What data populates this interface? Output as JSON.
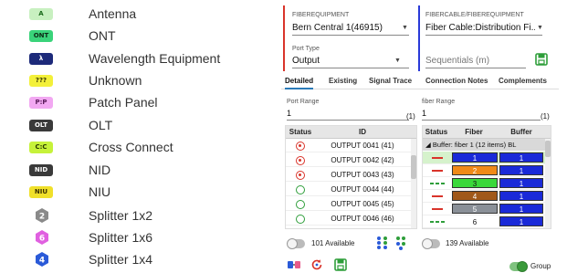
{
  "legend": [
    {
      "badge": "A",
      "label": "Antenna",
      "bg": "#c8f0c0",
      "fg": "#1b6b1b",
      "shape": "badge"
    },
    {
      "badge": "ONT",
      "label": "ONT",
      "bg": "#3ad37a",
      "fg": "#0d2a17",
      "shape": "badge"
    },
    {
      "badge": "λ",
      "label": "Wavelength Equipment",
      "bg": "#1d2a7a",
      "fg": "#ffffff",
      "shape": "badge"
    },
    {
      "badge": "???",
      "label": "Unknown",
      "bg": "#f3f03a",
      "fg": "#333300",
      "shape": "badge"
    },
    {
      "badge": "P:P",
      "label": "Patch Panel",
      "bg": "#f2a8f2",
      "fg": "#5a1a5a",
      "shape": "badge"
    },
    {
      "badge": "OLT",
      "label": "OLT",
      "bg": "#3a3a3a",
      "fg": "#ffffff",
      "shape": "badge"
    },
    {
      "badge": "C:C",
      "label": "Cross Connect",
      "bg": "#c6f23a",
      "fg": "#2a3a00",
      "shape": "badge"
    },
    {
      "badge": "NID",
      "label": "NID",
      "bg": "#3a3a3a",
      "fg": "#ffffff",
      "shape": "badge"
    },
    {
      "badge": "NIU",
      "label": "NIU",
      "bg": "#f0e02a",
      "fg": "#3a3000",
      "shape": "badge"
    },
    {
      "badge": "2",
      "label": "Splitter 1x2",
      "bg": "#8a8a8a",
      "fg": "#ffffff",
      "shape": "hex"
    },
    {
      "badge": "6",
      "label": "Splitter 1x6",
      "bg": "#e060e0",
      "fg": "#ffffff",
      "shape": "hex"
    },
    {
      "badge": "4",
      "label": "Splitter 1x4",
      "bg": "#2a5ad8",
      "fg": "#ffffff",
      "shape": "hex"
    }
  ],
  "fiber_equipment": {
    "label": "FIBEREQUIPMENT",
    "value": "Bern Central 1(46915)",
    "bar_color": "#d9342b"
  },
  "fiber_cable": {
    "label": "FIBERCABLE/FIBEREQUIPMENT",
    "value": "Fiber Cable:Distribution Fi...",
    "bar_color": "#2a3ad8"
  },
  "port_type": {
    "label": "Port Type",
    "value": "Output"
  },
  "sequentials": {
    "placeholder": "Sequentials (m)"
  },
  "tabs": [
    "Detailed",
    "Existing",
    "Signal Trace",
    "Connection Notes",
    "Complements"
  ],
  "port_range": {
    "label": "Port Range",
    "value": "1",
    "count": "(1)"
  },
  "fiber_range": {
    "label": "fiber Range",
    "value": "1",
    "count": "(1)"
  },
  "left_table": {
    "headers": [
      "Status",
      "ID"
    ],
    "rows": [
      {
        "id": "OUTPUT 0041 (41)",
        "status": "red"
      },
      {
        "id": "OUTPUT 0042 (42)",
        "status": "red"
      },
      {
        "id": "OUTPUT 0043 (43)",
        "status": "red"
      },
      {
        "id": "OUTPUT 0044 (44)",
        "status": "green"
      },
      {
        "id": "OUTPUT 0045 (45)",
        "status": "green"
      },
      {
        "id": "OUTPUT 0046 (46)",
        "status": "green"
      }
    ]
  },
  "right_table": {
    "headers": [
      "Status",
      "Fiber",
      "Buffer"
    ],
    "group_label": "Buffer: fiber 1 (12 items) BL",
    "rows": [
      {
        "fiber": "1",
        "fiber_color": "#1a2ad8",
        "buffer": "1",
        "dash": "red",
        "highlight": true
      },
      {
        "fiber": "2",
        "fiber_color": "#f08a18",
        "buffer": "1",
        "dash": "red",
        "highlight": false
      },
      {
        "fiber": "3",
        "fiber_color": "#3ad83a",
        "buffer": "1",
        "dash": "green",
        "highlight": false
      },
      {
        "fiber": "4",
        "fiber_color": "#a0581a",
        "buffer": "1",
        "dash": "red",
        "highlight": false
      },
      {
        "fiber": "5",
        "fiber_color": "#8a9098",
        "buffer": "1",
        "dash": "red",
        "highlight": false
      },
      {
        "fiber": "6",
        "fiber_color": "#ffffff",
        "buffer": "1",
        "dash": "green",
        "highlight": false
      }
    ]
  },
  "left_available": "101 Available",
  "right_available": "139 Available",
  "group_toggle_label": "Group"
}
